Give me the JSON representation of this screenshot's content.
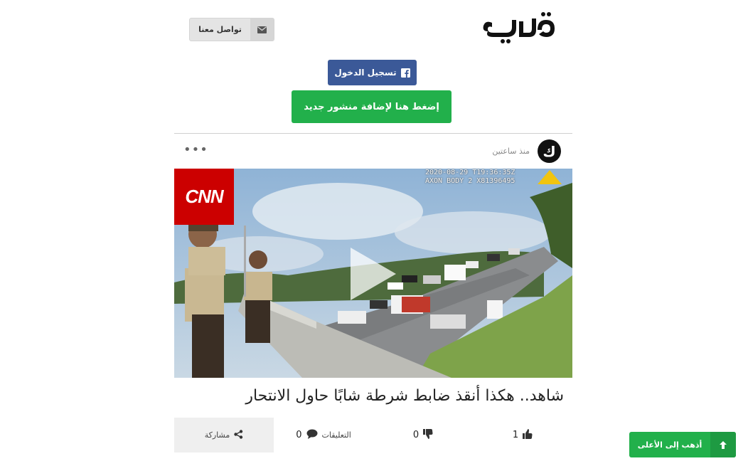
{
  "header": {
    "logo_text": "كيف",
    "contact_label": "تواصل معنا",
    "contact_icon": "envelope-icon",
    "login_label": "تسجيل الدخول",
    "login_icon": "facebook-icon",
    "new_post_label": "إضغط هنا لإضافة منشور جديد"
  },
  "post": {
    "avatar_letter": "ك",
    "time": "منذ ساعتين",
    "more_label": "•••",
    "video": {
      "channel_logo": "CNN",
      "stamp_line1": "2020-08-29 T19:36:35Z",
      "stamp_line2": "AXON BODY 2 X81396495"
    },
    "title": "شاهد.. هكذا أنقذ ضابط شرطة شابًا حاول الانتحار",
    "likes": "1",
    "dislikes": "0",
    "comments_count": "0",
    "comments_label": "التعليقات",
    "share_label": "مشاركة"
  },
  "scroll_top": {
    "label": "أذهب إلى الأعلى",
    "icon": "arrow-up-icon"
  },
  "colors": {
    "green": "#22b04b",
    "facebook": "#3b5998",
    "cnn_red": "#cc0000"
  }
}
